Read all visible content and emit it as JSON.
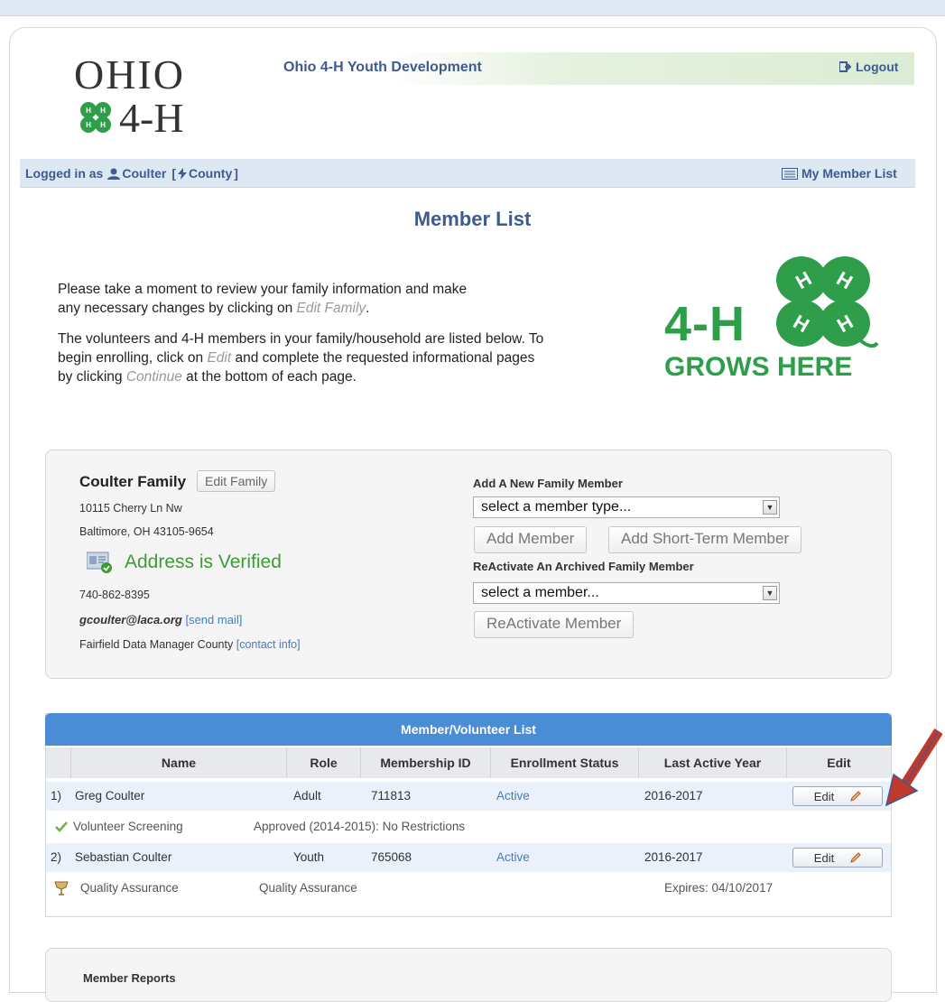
{
  "header": {
    "logo_word": "OHIO",
    "logo_suffix": "4-H",
    "site_title": "Ohio 4-H Youth Development",
    "logout_label": "Logout"
  },
  "nav": {
    "logged_in_prefix": "Logged in as",
    "user_name": "Coulter",
    "user_role_open": "[",
    "user_role": "County",
    "user_role_close": "]",
    "my_member_list": "My Member List"
  },
  "page": {
    "title": "Member List",
    "intro_p1_a": "Please take a moment to review your family information and make any necessary changes by clicking on ",
    "intro_p1_link": "Edit Family",
    "intro_p1_b": ".",
    "intro_p2_a": "The volunteers and 4-H members in your family/household are listed below. To begin enrolling, click on ",
    "intro_p2_link1": "Edit",
    "intro_p2_b": " and complete the requested informational pages by clicking ",
    "intro_p2_link2": "Continue",
    "intro_p2_c": " at the bottom of each page.",
    "grows_line1": "4-H",
    "grows_line2": "GROWS HERE"
  },
  "family": {
    "name": "Coulter Family",
    "edit_family_label": "Edit Family",
    "address1": "10115 Cherry Ln Nw",
    "address2": "Baltimore, OH 43105-9654",
    "verified_text": "Address is Verified",
    "phone": "740-862-8395",
    "email": "gcoulter@laca.org",
    "send_mail": "[send mail]",
    "manager": "Fairfield Data Manager County",
    "contact_info": "[contact info]",
    "add_new_label": "Add A New Family Member",
    "member_type_select": "select a member type...",
    "add_member_btn": "Add Member",
    "add_short_term_btn": "Add Short-Term Member",
    "reactivate_label": "ReActivate An Archived Family Member",
    "member_select": "select a member...",
    "reactivate_btn": "ReActivate Member"
  },
  "table": {
    "title": "Member/Volunteer List",
    "columns": [
      "Name",
      "Role",
      "Membership ID",
      "Enrollment Status",
      "Last Active Year",
      "Edit"
    ],
    "rows": [
      {
        "index": "1)",
        "name": "Greg Coulter",
        "role": "Adult",
        "membership_id": "711813",
        "status": "Active",
        "last_year": "2016-2017",
        "edit_label": "Edit",
        "sub_label": "Volunteer Screening",
        "sub_value": "Approved (2014-2015): No Restrictions",
        "sub_expires": ""
      },
      {
        "index": "2)",
        "name": "Sebastian Coulter",
        "role": "Youth",
        "membership_id": "765068",
        "status": "Active",
        "last_year": "2016-2017",
        "edit_label": "Edit",
        "sub_label": "Quality Assurance",
        "sub_value": "Quality Assurance",
        "sub_expires": "Expires: 04/10/2017"
      }
    ]
  },
  "reports": {
    "title": "Member Reports"
  },
  "colors": {
    "brand_blue": "#3d5b8f",
    "table_header": "#4a8cd6",
    "clover_green": "#2e9e4b",
    "verified_green": "#3e9b35",
    "arrow_red": "#c0392b"
  }
}
